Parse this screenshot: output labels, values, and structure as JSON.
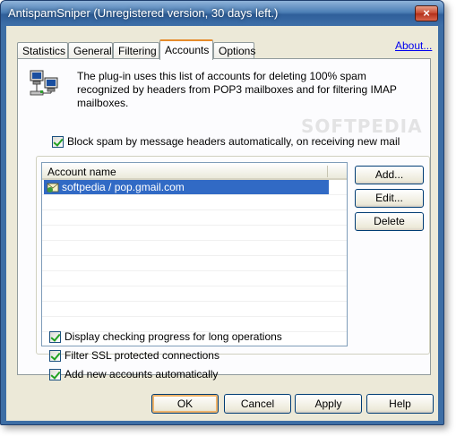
{
  "window": {
    "title": "AntispamSniper (Unregistered version, 30 days left.)",
    "close_glyph": "×"
  },
  "tabs": [
    {
      "label": "Statistics",
      "active": false
    },
    {
      "label": "General",
      "active": false
    },
    {
      "label": "Filtering",
      "active": false
    },
    {
      "label": "Accounts",
      "active": true
    },
    {
      "label": "Options",
      "active": false
    }
  ],
  "about_link": "About...",
  "accounts_page": {
    "icon": "network-computers-icon",
    "description": "The plug-in uses this list of accounts for deleting 100% spam recognized by headers from POP3 mailboxes and for filtering IMAP mailboxes.",
    "block_spam_checkbox": {
      "label": "Block spam by message headers automatically, on receiving new mail",
      "checked": true
    },
    "list": {
      "column_header": "Account name",
      "rows": [
        {
          "name": "softpedia / pop.gmail.com",
          "selected": true,
          "icon": "mail-account-icon"
        }
      ]
    },
    "buttons": {
      "add": "Add...",
      "edit": "Edit...",
      "delete": "Delete"
    },
    "options": [
      {
        "label": "Display checking progress for long operations",
        "checked": true
      },
      {
        "label": "Filter SSL protected connections",
        "checked": true
      },
      {
        "label": "Add new accounts automatically",
        "checked": true
      }
    ]
  },
  "dialog_buttons": {
    "ok": "OK",
    "cancel": "Cancel",
    "apply": "Apply",
    "help": "Help"
  },
  "watermark": "SOFTPEDIA",
  "colors": {
    "selection": "#316ac5",
    "title_bar": "#3e6fa8",
    "dialog_bg": "#ece9d8",
    "link": "#0000ee",
    "active_tab_accent": "#e68b2c"
  }
}
